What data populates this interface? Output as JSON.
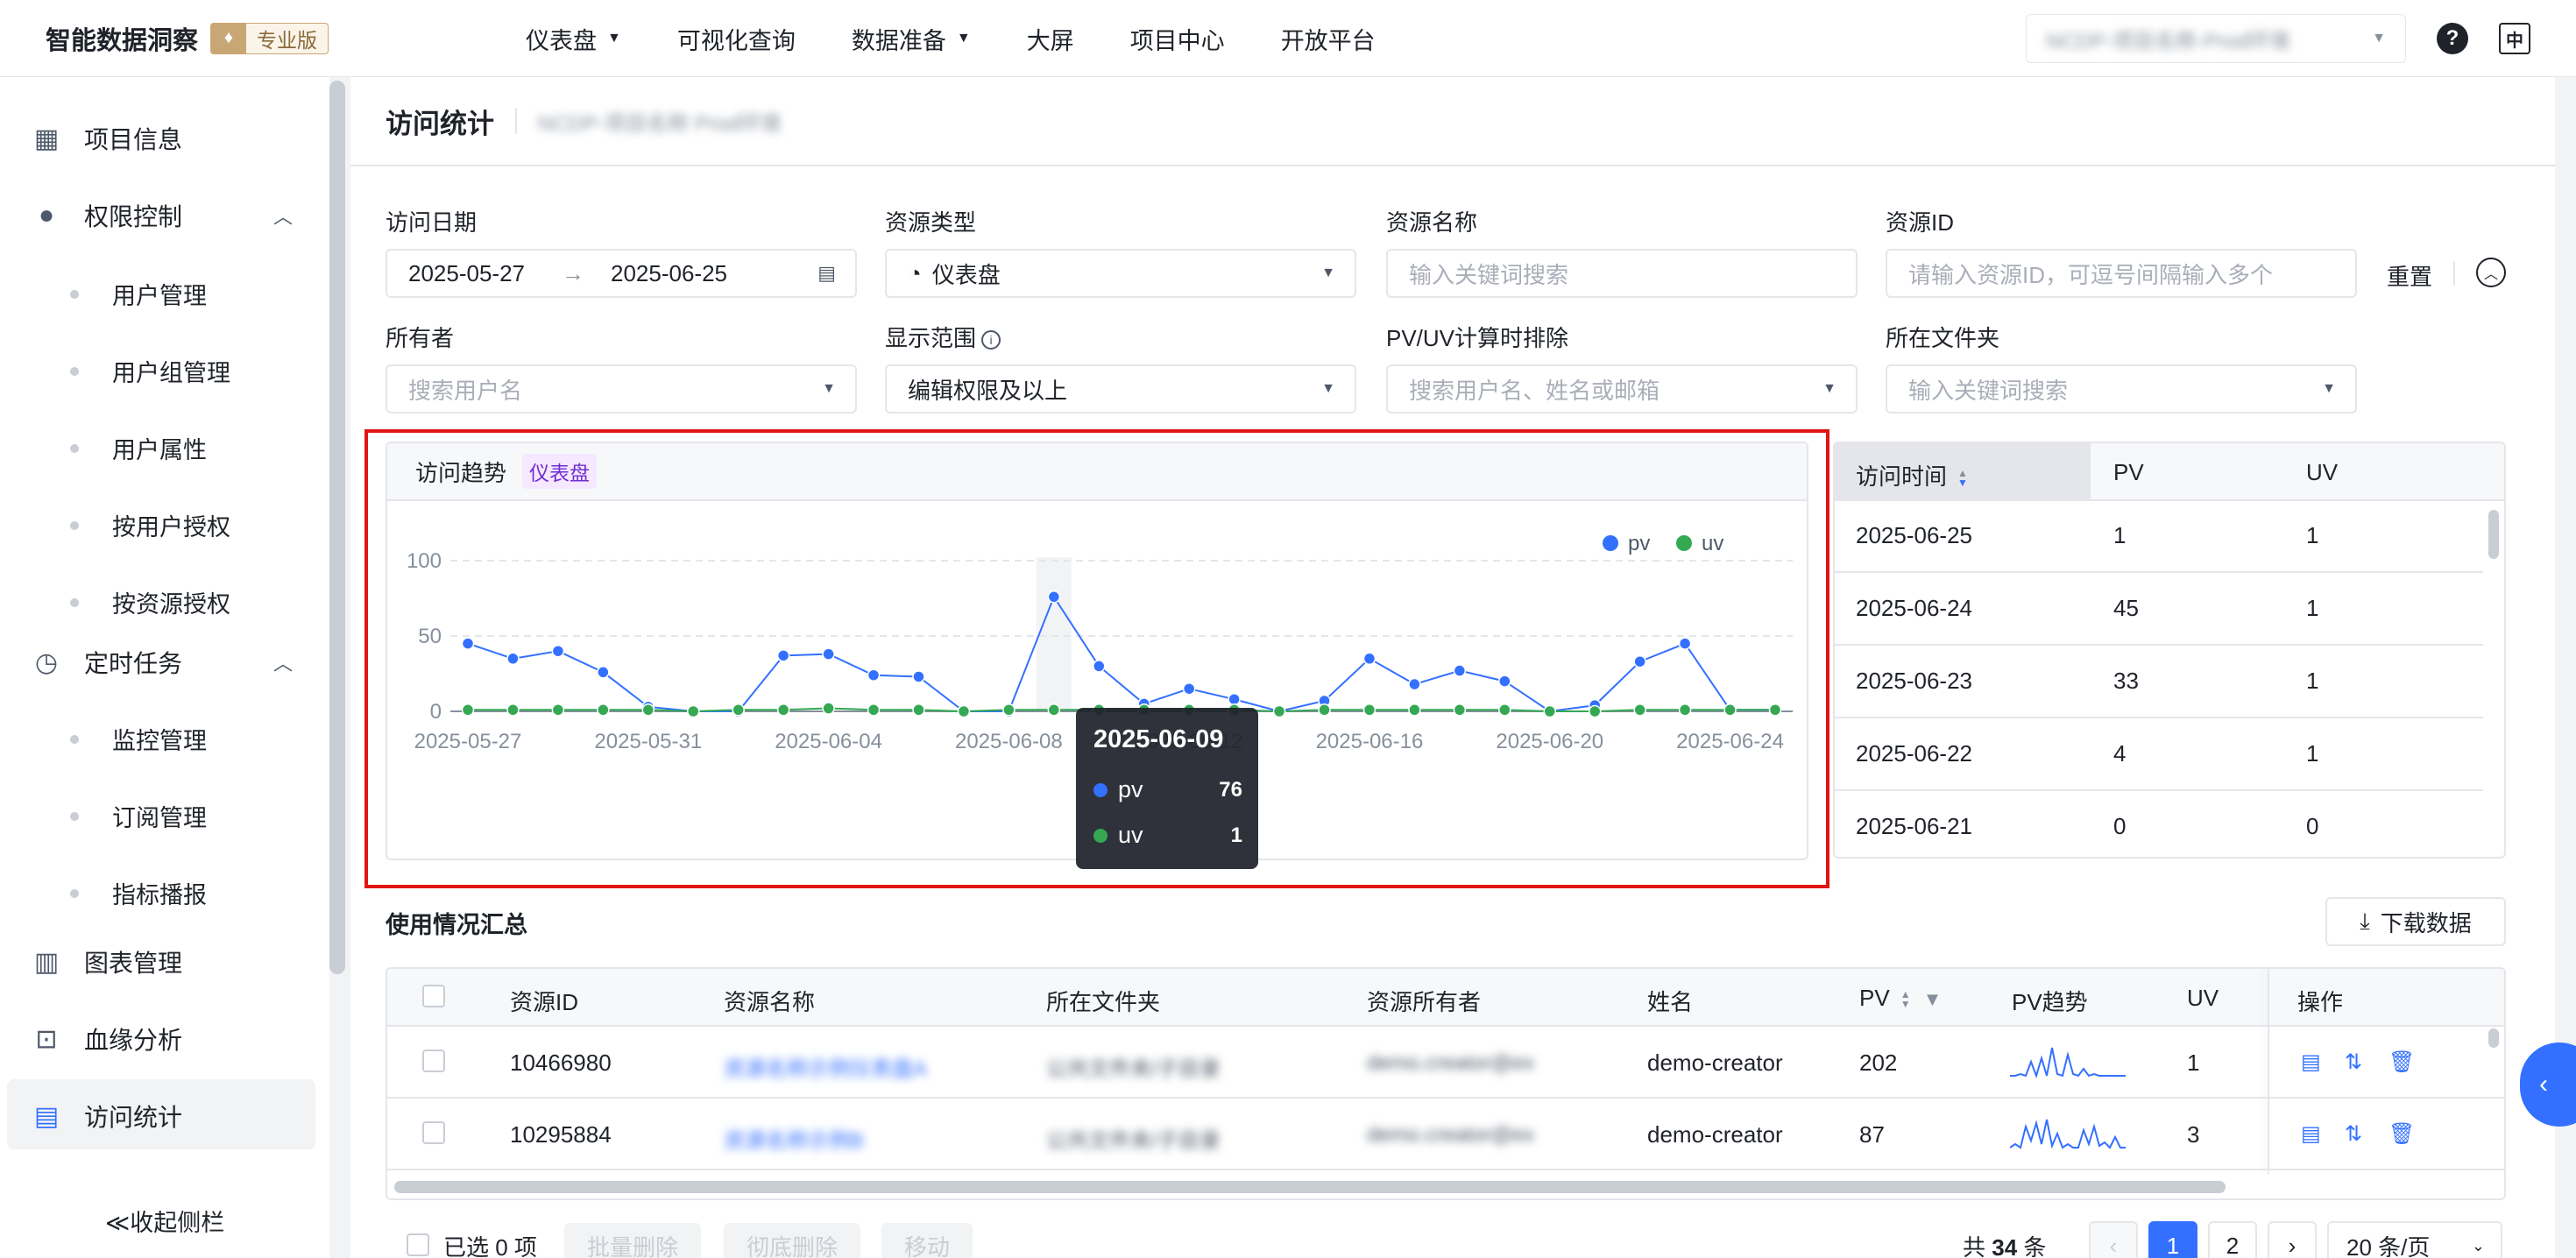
{
  "brand": {
    "title": "智能数据洞察",
    "edition": "专业版"
  },
  "topnav": [
    {
      "label": "仪表盘",
      "dropdown": true
    },
    {
      "label": "可视化查询",
      "dropdown": false
    },
    {
      "label": "数据准备",
      "dropdown": true
    },
    {
      "label": "大屏",
      "dropdown": false
    },
    {
      "label": "项目中心",
      "dropdown": false
    },
    {
      "label": "开放平台",
      "dropdown": false
    }
  ],
  "topbar": {
    "project_blurred": "NCDP-项目名称-Prod环境",
    "help_icon": "?",
    "lang_icon": "中"
  },
  "sidebar": {
    "items": [
      {
        "label": "项目信息",
        "icon": "grid-icon"
      },
      {
        "label": "权限控制",
        "icon": "key-icon"
      },
      {
        "label": "用户管理"
      },
      {
        "label": "用户组管理"
      },
      {
        "label": "用户属性"
      },
      {
        "label": "按用户授权"
      },
      {
        "label": "按资源授权"
      },
      {
        "label": "定时任务",
        "icon": "clock-icon"
      },
      {
        "label": "监控管理"
      },
      {
        "label": "订阅管理"
      },
      {
        "label": "指标播报"
      },
      {
        "label": "图表管理",
        "icon": "bar-chart-icon"
      },
      {
        "label": "血缘分析",
        "icon": "lineage-icon"
      },
      {
        "label": "访问统计",
        "icon": "search-chart-icon"
      }
    ],
    "collapse_label": "≪收起侧栏"
  },
  "page": {
    "title": "访问统计",
    "subtitle_blurred": "NCDP-项目名称 Prod环境"
  },
  "filters": {
    "date": {
      "label": "访问日期",
      "start": "2025-05-27",
      "end": "2025-06-25"
    },
    "type": {
      "label": "资源类型",
      "value": "仪表盘"
    },
    "name": {
      "label": "资源名称",
      "placeholder": "输入关键词搜索"
    },
    "id": {
      "label": "资源ID",
      "placeholder": "请输入资源ID，可逗号间隔输入多个"
    },
    "reset": "重置",
    "owner": {
      "label": "所有者",
      "placeholder": "搜索用户名"
    },
    "scope": {
      "label": "显示范围",
      "value": "编辑权限及以上"
    },
    "exclude": {
      "label": "PV/UV计算时排除",
      "placeholder": "搜索用户名、姓名或邮箱"
    },
    "folder": {
      "label": "所在文件夹",
      "placeholder": "输入关键词搜索"
    }
  },
  "chart_card": {
    "title": "访问趋势",
    "tag": "仪表盘"
  },
  "chart_data": {
    "type": "line",
    "title": "",
    "x": [
      "2025-05-27",
      "2025-05-28",
      "2025-05-29",
      "2025-05-30",
      "2025-05-31",
      "2025-06-01",
      "2025-06-02",
      "2025-06-03",
      "2025-06-04",
      "2025-06-05",
      "2025-06-06",
      "2025-06-07",
      "2025-06-08",
      "2025-06-09",
      "2025-06-10",
      "2025-06-11",
      "2025-06-12",
      "2025-06-13",
      "2025-06-14",
      "2025-06-15",
      "2025-06-16",
      "2025-06-17",
      "2025-06-18",
      "2025-06-19",
      "2025-06-20",
      "2025-06-21",
      "2025-06-22",
      "2025-06-23",
      "2025-06-24",
      "2025-06-25"
    ],
    "x_ticks": [
      "2025-05-27",
      "2025-05-31",
      "2025-06-04",
      "2025-06-08",
      "2025-06-12",
      "2025-06-16",
      "2025-06-20",
      "2025-06-24"
    ],
    "series": [
      {
        "name": "pv",
        "color": "#3370ff",
        "values": [
          45,
          35,
          40,
          26,
          3,
          0,
          0,
          37,
          38,
          24,
          23,
          0,
          0,
          76,
          30,
          5,
          15,
          8,
          0,
          7,
          35,
          18,
          27,
          20,
          0,
          4,
          33,
          45,
          1,
          1
        ]
      },
      {
        "name": "uv",
        "color": "#34a853",
        "values": [
          1,
          1,
          1,
          1,
          1,
          0,
          1,
          1,
          2,
          1,
          1,
          0,
          1,
          1,
          1,
          1,
          1,
          1,
          0,
          1,
          1,
          1,
          1,
          1,
          0,
          0,
          1,
          1,
          1,
          1
        ]
      }
    ],
    "y_ticks": [
      0,
      50,
      100
    ],
    "ylim": [
      0,
      100
    ],
    "grid": true,
    "legend": "top-right",
    "highlight_index": 13
  },
  "tooltip": {
    "date": "2025-06-09",
    "pv_label": "pv",
    "pv": "76",
    "uv_label": "uv",
    "uv": "1"
  },
  "side_table": {
    "headers": [
      "访问时间",
      "PV",
      "UV"
    ],
    "rows": [
      [
        "2025-06-25",
        "1",
        "1"
      ],
      [
        "2025-06-24",
        "45",
        "1"
      ],
      [
        "2025-06-23",
        "33",
        "1"
      ],
      [
        "2025-06-22",
        "4",
        "1"
      ],
      [
        "2025-06-21",
        "0",
        "0"
      ]
    ]
  },
  "usage": {
    "title": "使用情况汇总",
    "download": "下载数据",
    "headers": [
      "资源ID",
      "资源名称",
      "所在文件夹",
      "资源所有者",
      "姓名",
      "PV",
      "PV趋势",
      "UV",
      "操作"
    ],
    "rows": [
      {
        "id": "10466980",
        "name_blurred": "资源名称示例仪表盘A",
        "folder_blurred": "公共文件夹/子目录",
        "owner_blurred": "demo.creator@ex",
        "person": "demo-creator",
        "pv": "202",
        "uv": "1"
      },
      {
        "id": "10295884",
        "name_blurred": "资源名称示例B",
        "folder_blurred": "公共文件夹/子目录",
        "owner_blurred": "demo.creator@ex",
        "person": "demo-creator",
        "pv": "87",
        "uv": "3"
      }
    ]
  },
  "footer": {
    "selected": "已选 0 项",
    "batch_delete": "批量删除",
    "purge": "彻底删除",
    "move": "移动",
    "total_prefix": "共",
    "total": "34",
    "total_suffix": "条",
    "pages": [
      "1",
      "2"
    ],
    "page_size": "20 条/页"
  }
}
